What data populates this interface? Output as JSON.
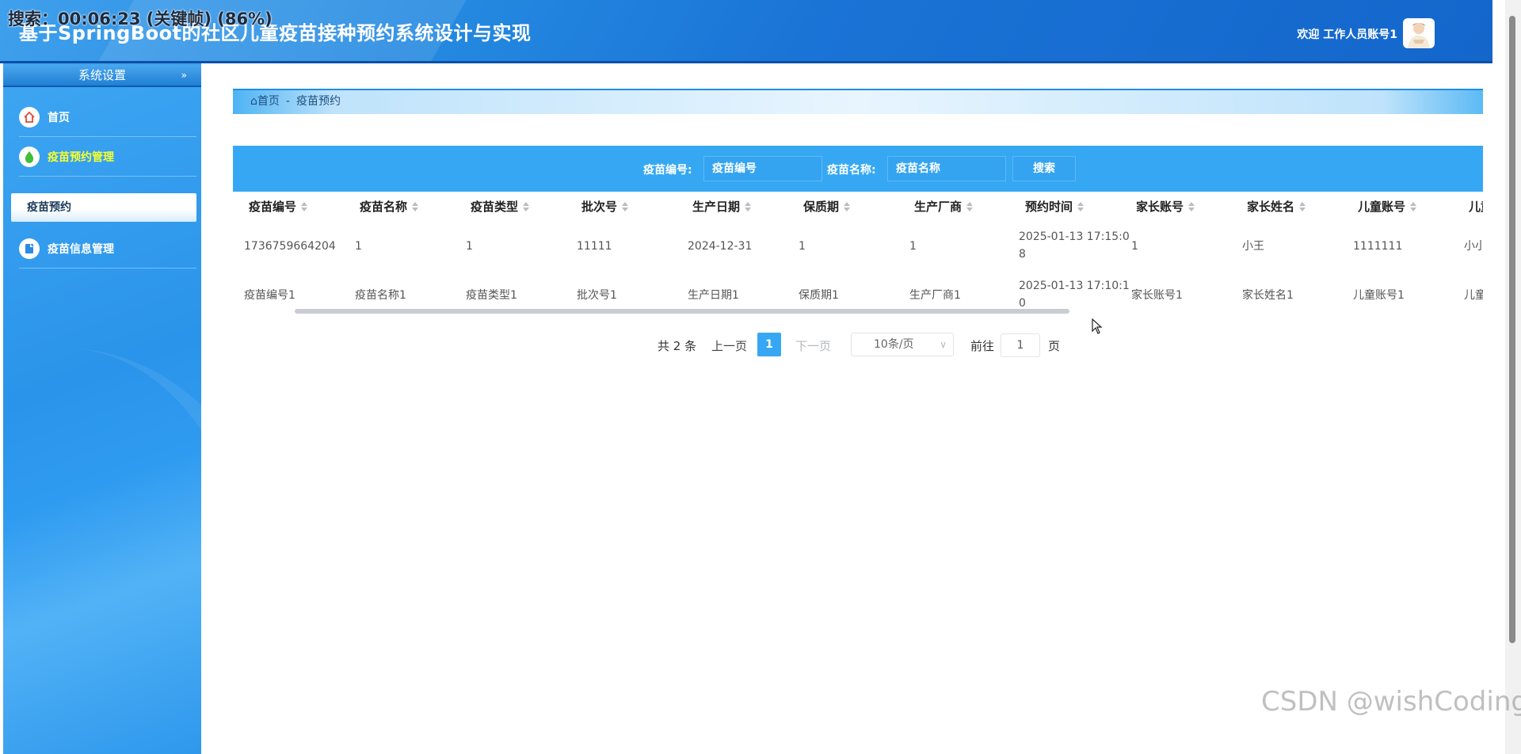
{
  "overlay_caption": "搜索：00:06:23 (关键帧) (86%)",
  "header": {
    "title": "基于SpringBoot的社区儿童疫苗接种预约系统设计与实现",
    "welcome": "欢迎 工作人员账号1"
  },
  "sidebar": {
    "section_title": "系统设置",
    "items": [
      {
        "label": "首页",
        "icon": "home-icon"
      },
      {
        "label": "疫苗预约管理",
        "icon": "drop-icon"
      },
      {
        "label": "疫苗预约"
      },
      {
        "label": "疫苗信息管理",
        "icon": "note-icon"
      }
    ]
  },
  "breadcrumb": {
    "home": "首页",
    "sep": "-",
    "current": "疫苗预约"
  },
  "search": {
    "field1_label": "疫苗编号:",
    "field1_placeholder": "疫苗编号",
    "field2_label": "疫苗名称:",
    "field2_placeholder": "疫苗名称",
    "button": "搜索"
  },
  "table": {
    "columns": [
      "疫苗编号",
      "疫苗名称",
      "疫苗类型",
      "批次号",
      "生产日期",
      "保质期",
      "生产厂商",
      "预约时间",
      "家长账号",
      "家长姓名",
      "儿童账号",
      "儿童"
    ],
    "rows": [
      [
        "1736759664204",
        "1",
        "1",
        "11111",
        "2024-12-31",
        "1",
        "1",
        "2025-01-13 17:15:0",
        "8",
        "1",
        "小王",
        "1111111",
        "小小"
      ],
      [
        "疫苗编号1",
        "疫苗名称1",
        "疫苗类型1",
        "批次号1",
        "生产日期1",
        "保质期1",
        "生产厂商1",
        "2025-01-13 17:10:1",
        "0",
        "家长账号1",
        "家长姓名1",
        "儿童账号1",
        "儿童"
      ]
    ]
  },
  "pagination": {
    "total": "共 2 条",
    "prev": "上一页",
    "current_page": "1",
    "next": "下一页",
    "page_size": "10条/页",
    "goto": "前往",
    "goto_value": "1",
    "page_suffix": "页"
  },
  "watermark": "CSDN @wishCoding",
  "colors": {
    "header": "#1a73d6",
    "sidebar": "#2a94ea",
    "accent": "#36a8f3",
    "active_menu_text": "#f5ff30"
  }
}
